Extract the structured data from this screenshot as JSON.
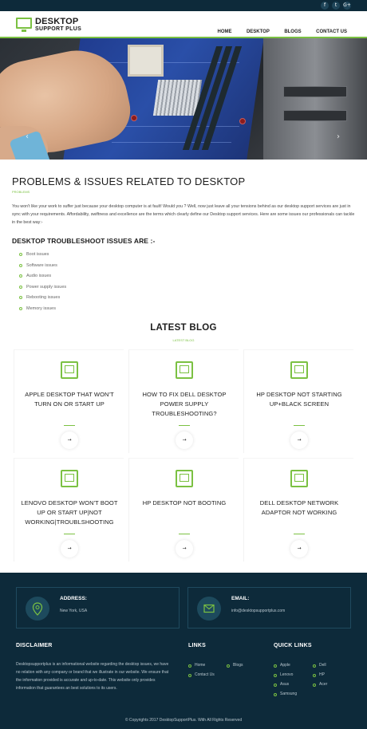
{
  "header": {
    "logo_line1": "DESKTOP",
    "logo_line2": "SUPPORT PLUS",
    "nav": [
      "HOME",
      "DESKTOP",
      "BLOGS",
      "CONTACT US"
    ],
    "social": [
      "f",
      "t",
      "G+"
    ]
  },
  "hero": {
    "prev_arrow": "‹",
    "next_arrow": "›"
  },
  "problems": {
    "title": "PROBLEMS & ISSUES RELATED TO DESKTOP",
    "subtitle": "PROBLEMS",
    "paragraph": "You won't like your work to suffer just because your desktop computer is at fault! Would you ? Well, now just leave all your tensions behind as our desktop support services are just in sync with your requirements. Affordability, swiftness and excellence are the terms which clearly define our Desktop support services. Here are some issues our professionals can tackle in the best way:-",
    "list_title": "DESKTOP TROUBLESHOOT ISSUES ARE :-",
    "issues": [
      "Boot issues",
      "Software issues",
      "Audio issues",
      "Power supply issues",
      "Rebooting issues",
      "Memory issues"
    ]
  },
  "blog": {
    "title": "LATEST BLOG",
    "subtitle": "LATEST BLOG",
    "cards": [
      {
        "title": "APPLE DESKTOP THAT WON'T TURN ON OR START UP",
        "btn": "→"
      },
      {
        "title": "HOW TO FIX DELL DESKTOP POWER SUPPLY TROUBLESHOOTING?",
        "btn": "→"
      },
      {
        "title": "HP DESKTOP NOT STARTING UP+BLACK SCREEN",
        "btn": "→"
      },
      {
        "title": "LENOVO DESKTOP WON'T BOOT UP OR START UP|NOT WORKING|TROUBLSHOOTING",
        "btn": "→"
      },
      {
        "title": "HP DESKTOP NOT BOOTING",
        "btn": "→"
      },
      {
        "title": "DELL DESKTOP NETWORK ADAPTOR NOT WORKING",
        "btn": "→"
      }
    ]
  },
  "footer": {
    "address_label": "ADDRESS:",
    "address_value": "New York, USA",
    "email_label": "EMAIL:",
    "email_value": "info@desktopsupportplus.com",
    "disclaimer_title": "DISCLAIMER",
    "disclaimer_text": "Desktopsupportplus is an informational website regarding the desktop issues, we have no relation with any company or brand that we illustrate in our website. We ensure that the information provided is accurate and up-to-date. This website only provides information that guarantees an best solutions to its users.",
    "links_title": "LINKS",
    "links": [
      "Home",
      "Blogs",
      "Contact Us"
    ],
    "quick_title": "QUICK LINKS",
    "quick_links": [
      "Apple",
      "Dell",
      "Lenovo",
      "HP",
      "Asus",
      "Acer",
      "Samsung"
    ],
    "copyright": "© Copyrights 2017 DesktopSupportPlus. With All Rights Reserved"
  },
  "colors": {
    "accent": "#7bc142",
    "dark": "#0d2a3a"
  }
}
